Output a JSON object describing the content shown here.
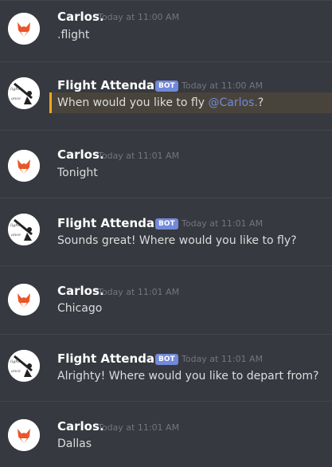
{
  "messages": [
    {
      "author": "Carlos.",
      "avatar": "fox-avatar-icon",
      "is_bot": false,
      "timestamp": "Today at 11:00 AM",
      "text": ".flight"
    },
    {
      "author": "Flight Attendance",
      "avatar": "dancers-avatar-icon",
      "is_bot": true,
      "bot_label": "BOT",
      "timestamp": "Today at 11:00 AM",
      "text_before": "When would you like to fly ",
      "mention": "@Carlos.",
      "text_after": "?"
    },
    {
      "author": "Carlos.",
      "avatar": "fox-avatar-icon",
      "is_bot": false,
      "timestamp": "Today at 11:01 AM",
      "text": "Tonight"
    },
    {
      "author": "Flight Attendance",
      "avatar": "dancers-avatar-icon",
      "is_bot": true,
      "bot_label": "BOT",
      "timestamp": "Today at 11:01 AM",
      "text": "Sounds great! Where would you like to fly?"
    },
    {
      "author": "Carlos.",
      "avatar": "fox-avatar-icon",
      "is_bot": false,
      "timestamp": "Today at 11:01 AM",
      "text": "Chicago"
    },
    {
      "author": "Flight Attendance",
      "avatar": "dancers-avatar-icon",
      "is_bot": true,
      "bot_label": "BOT",
      "timestamp": "Today at 11:01 AM",
      "text": "Alrighty! Where would you like to depart from?"
    },
    {
      "author": "Carlos.",
      "avatar": "fox-avatar-icon",
      "is_bot": false,
      "timestamp": "Today at 11:01 AM",
      "text": "Dallas"
    }
  ],
  "colors": {
    "background": "#36393f",
    "bot_tag": "#7289da",
    "mention": "#7289da",
    "mention_bar": "#faa61a",
    "fox": "#e8572a"
  }
}
